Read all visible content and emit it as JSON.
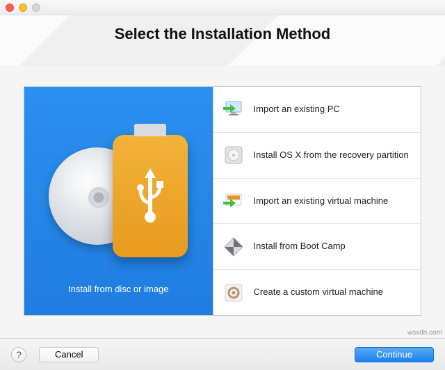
{
  "window": {
    "title": "Select the Installation Method"
  },
  "selected_tile": {
    "label": "Install from disc or image"
  },
  "options": [
    {
      "label": "Import an existing PC",
      "icon": "monitor-arrow-icon"
    },
    {
      "label": "Install OS X from the recovery partition",
      "icon": "disk-icon"
    },
    {
      "label": "Import an existing virtual machine",
      "icon": "vm-arrow-icon"
    },
    {
      "label": "Install from Boot Camp",
      "icon": "bootcamp-icon"
    },
    {
      "label": "Create a custom virtual machine",
      "icon": "gear-circle-icon"
    }
  ],
  "footer": {
    "help": "?",
    "cancel": "Cancel",
    "continue": "Continue"
  },
  "watermark": "wsxdn.com",
  "colors": {
    "primary_blue": "#2c90f0",
    "accent_orange": "#e79a1e"
  }
}
